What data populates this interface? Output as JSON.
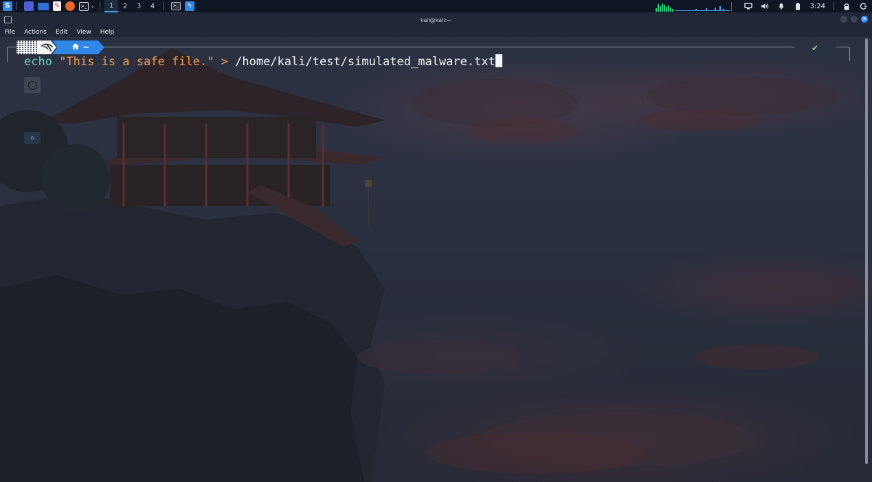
{
  "taskbar": {
    "workspaces": [
      "1",
      "2",
      "3",
      "4"
    ],
    "active_workspace": "1",
    "clock": "3:24",
    "icons": [
      "kali-menu-icon",
      "desktop-icon",
      "files-icon",
      "text-editor-icon",
      "firefox-icon",
      "terminal-icon",
      "chevron-down-icon",
      "terminal-window-icon",
      "app-switch-icon"
    ]
  },
  "window": {
    "title": "kali@kali:~"
  },
  "menu": {
    "items": [
      "File",
      "Actions",
      "Edit",
      "View",
      "Help"
    ]
  },
  "terminal": {
    "prompt_dir": "~",
    "status_symbol": "✔",
    "command": {
      "keyword": "echo",
      "string": "\"This is a safe file.\"",
      "operator": ">",
      "path": "/home/kali/test/simulated_malware.txt"
    }
  },
  "colors": {
    "accent": "#2f87e8",
    "keyword": "#5fd0b8",
    "string": "#f29a52",
    "status_ok": "#7fd46b"
  }
}
